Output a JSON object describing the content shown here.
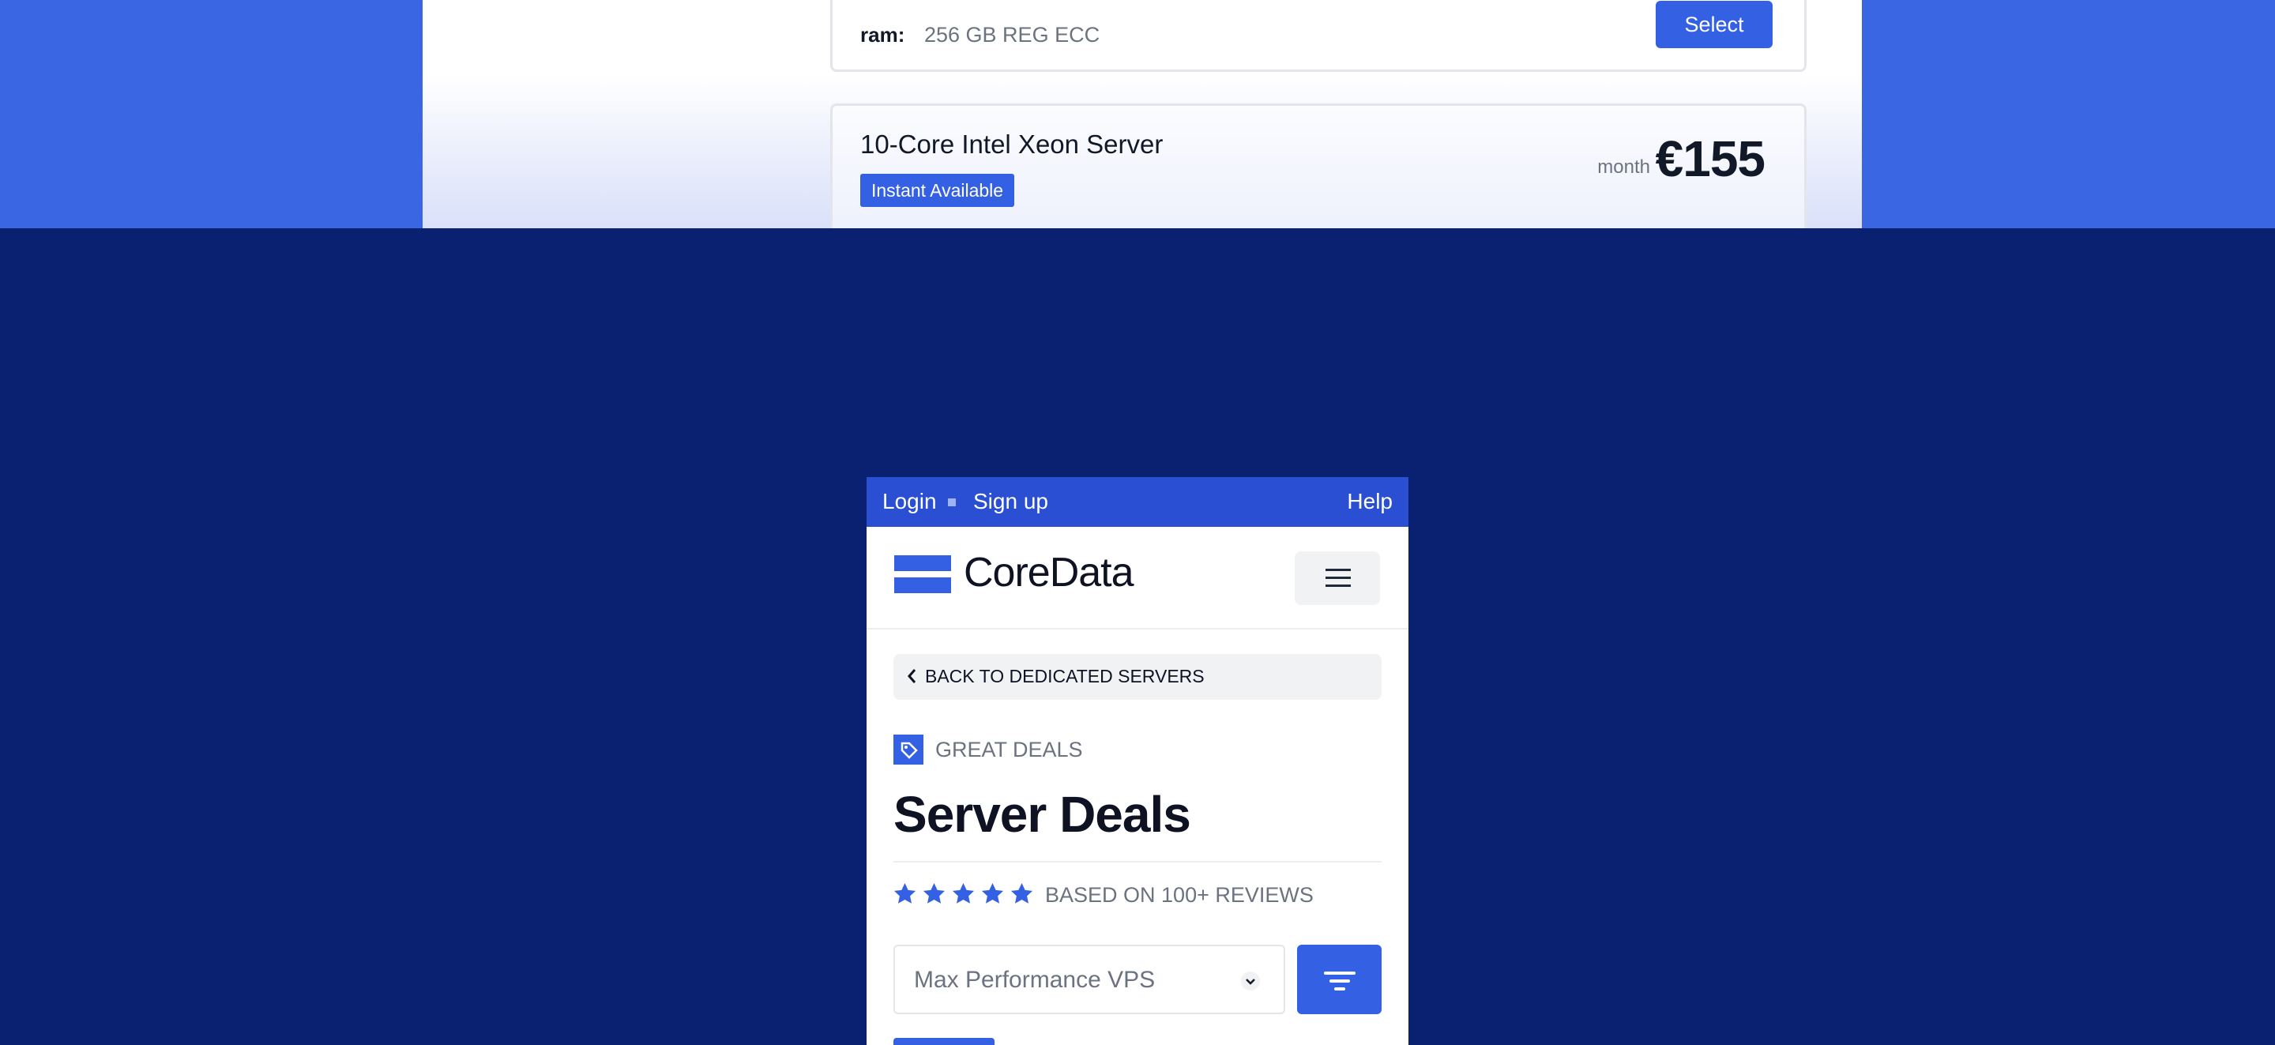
{
  "listing": {
    "card_a": {
      "spec_label": "ram:",
      "spec_value": "256 GB REG ECC",
      "select_label": "Select"
    },
    "card_b": {
      "title": "10-Core Intel Xeon Server",
      "badge": "Instant Available",
      "price_unit": "month",
      "price": "€155"
    }
  },
  "mobile": {
    "topbar": {
      "login": "Login",
      "signup": "Sign up",
      "help": "Help"
    },
    "header": {
      "brand": "CoreData"
    },
    "back_button": "BACK TO DEDICATED SERVERS",
    "section_label": "GREAT DEALS",
    "title": "Server Deals",
    "rating": {
      "stars": 5,
      "reviews_text": "BASED ON 100+ REVIEWS"
    },
    "filter": {
      "selected": "Max Performance VPS"
    }
  },
  "colors": {
    "accent": "#3460e4",
    "topbar": "#2a4fd2",
    "page_background": "#0a2070",
    "top_band": "#3a66e4"
  },
  "icons": [
    "logo-icon",
    "menu-icon",
    "chevron-left-icon",
    "price-tag-icon",
    "star-icon",
    "chevron-down-icon",
    "filter-icon"
  ]
}
